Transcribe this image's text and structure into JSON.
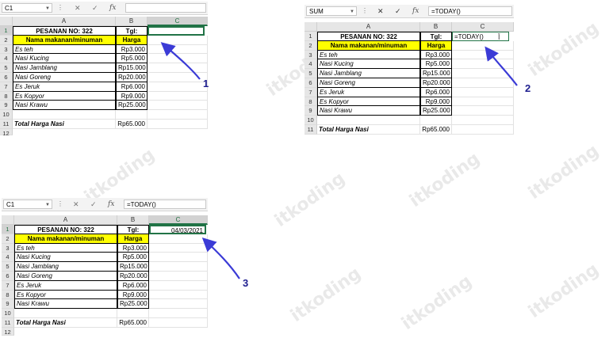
{
  "brand": {
    "watermark_text": "itkoding"
  },
  "colors": {
    "header_fill": "#ffff00",
    "active_border": "#217346",
    "arrow": "#3b3bd6"
  },
  "icons": {
    "cancel": "close-icon",
    "enter": "check-icon",
    "insert_function": "fx-icon"
  },
  "common": {
    "dots": "⋮",
    "cancel_glyph": "✕",
    "enter_glyph": "✓",
    "fx_label": "fx",
    "col_a": "A",
    "col_b": "B",
    "col_c": "C",
    "rows": [
      "1",
      "2",
      "3",
      "4",
      "5",
      "6",
      "7",
      "8",
      "9",
      "10",
      "11",
      "12"
    ],
    "r1_a": "PESANAN NO: 322",
    "r1_b": "Tgl:",
    "r2_a": "Nama makanan/minuman",
    "r2_b": "Harga",
    "items": [
      {
        "name": "Es teh",
        "price": "Rp3.000"
      },
      {
        "name": "Nasi Kucing",
        "price": "Rp5.000"
      },
      {
        "name": "Nasi Jamblang",
        "price": "Rp15.000"
      },
      {
        "name": "Nasi Goreng",
        "price": "Rp20.000"
      },
      {
        "name": "Es Jeruk",
        "price": "Rp6.000"
      },
      {
        "name": "Es Kopyor",
        "price": "Rp9.000"
      },
      {
        "name": "Nasi Krawu",
        "price": "Rp25.000"
      }
    ],
    "total_label": "Total Harga Nasi",
    "total_value": "Rp65.000"
  },
  "panel1": {
    "name_box": "C1",
    "formula": "",
    "c1": "",
    "step": "1"
  },
  "panel2": {
    "name_box": "SUM",
    "formula": "=TODAY()",
    "c1": "=TODAY()",
    "step": "2"
  },
  "panel3": {
    "name_box": "C1",
    "formula": "=TODAY()",
    "c1": "04/03/2021",
    "step": "3"
  }
}
